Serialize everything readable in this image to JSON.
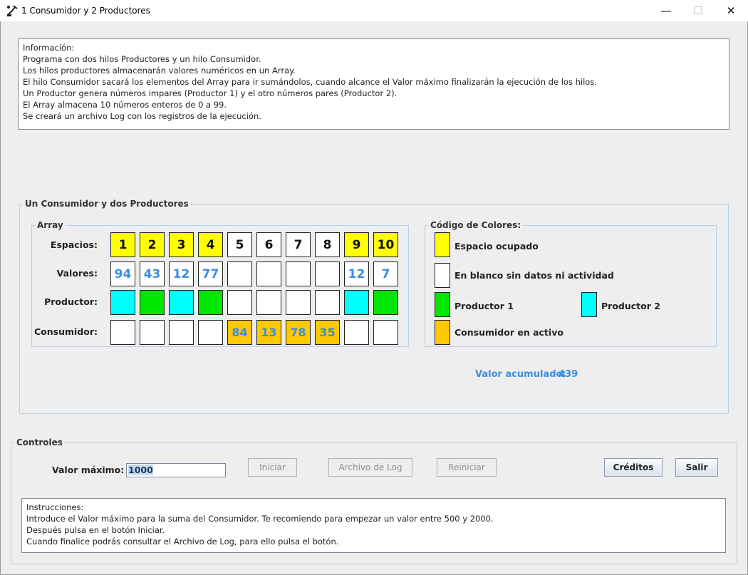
{
  "window": {
    "title": "1 Consumidor y 2 Productores",
    "minimize_glyph": "—",
    "maximize_glyph": "☐",
    "close_glyph": "✕"
  },
  "info": {
    "lines": [
      "Información:",
      "Programa con dos hilos Productores y un hilo Consumidor.",
      "Los hilos productores almacenarán valores numéricos en un Array.",
      "El hilo Consumidor sacará los elementos del Array para ir sumándolos, cuando alcance el Valor máximo finalizarán la ejecución de los hilos.",
      "Un Productor genera números impares (Productor 1) y el otro números pares (Productor 2).",
      "El Array almacena 10 números enteros de 0 a 99.",
      "Se creará un archivo Log con los registros de la ejecución."
    ]
  },
  "panel": {
    "title": "Un Consumidor y dos Productores",
    "array_title": "Array",
    "labels": {
      "espacios": "Espacios:",
      "valores": "Valores:",
      "productor": "Productor:",
      "consumidor": "Consumidor:"
    },
    "espacios": [
      "1",
      "2",
      "3",
      "4",
      "5",
      "6",
      "7",
      "8",
      "9",
      "10"
    ],
    "espacios_occupied": [
      true,
      true,
      true,
      true,
      false,
      false,
      false,
      false,
      true,
      true
    ],
    "valores": [
      "94",
      "43",
      "12",
      "77",
      "",
      "",
      "",
      "",
      "12",
      "7"
    ],
    "productor": [
      "p2",
      "p1",
      "p2",
      "p1",
      "",
      "",
      "",
      "",
      "p2",
      "p1"
    ],
    "consumidor": [
      "",
      "",
      "",
      "",
      "84",
      "13",
      "78",
      "35",
      "",
      ""
    ],
    "legend": {
      "title": "Código de Colores:",
      "ocupado": "Espacio ocupado",
      "blanco": "En blanco sin datos ni actividad",
      "productor1": "Productor 1",
      "productor2": "Productor 2",
      "consumidor": "Consumidor en activo"
    },
    "accumulated_label": "Valor acumulado:",
    "accumulated_value": "439"
  },
  "controls": {
    "title": "Controles",
    "max_label": "Valor máximo:",
    "max_value": "1000",
    "buttons": {
      "iniciar": "Iniciar",
      "log": "Archivo de Log",
      "reiniciar": "Reiniciar",
      "creditos": "Créditos",
      "salir": "Salir"
    }
  },
  "instructions": {
    "lines": [
      "Instrucciones:",
      "Introduce el Valor máximo para la suma del Consumidor. Te recomiendo para empezar un valor entre 500 y 2000.",
      "Después pulsa en el botón Iniciar.",
      "Cuando finalice podrás consultar el Archivo de Log, para ello pulsa el botón."
    ]
  },
  "colors": {
    "occupied": "#ffff00",
    "empty": "#ffffff",
    "productor1": "#00e600",
    "productor2": "#00ffff",
    "consumer": "#ffc800",
    "value_text": "#3b8de0"
  }
}
